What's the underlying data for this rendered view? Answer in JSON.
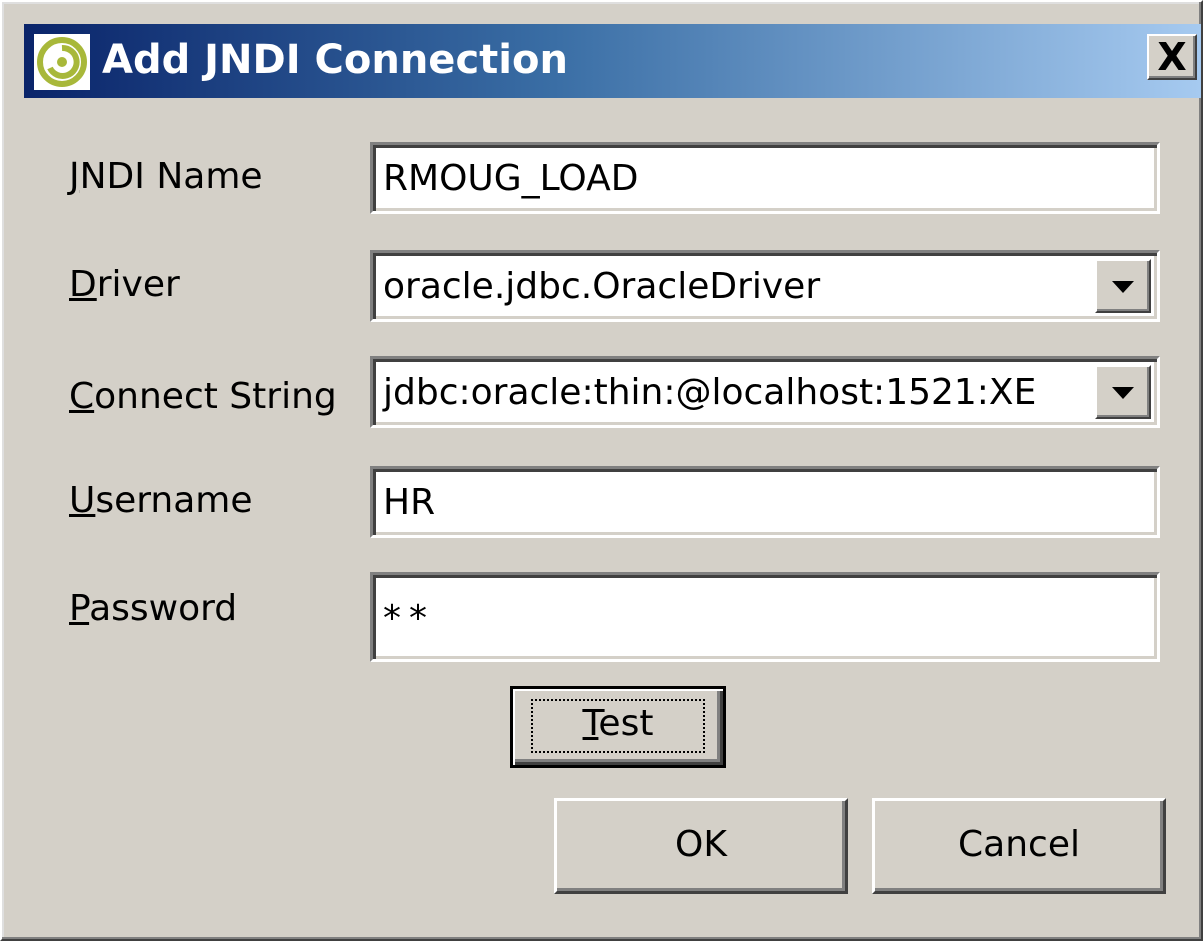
{
  "window": {
    "title": "Add JNDI Connection",
    "close_glyph": "X"
  },
  "form": {
    "jndi_name": {
      "label_mn": "J",
      "label_rest": "NDI Name",
      "value": "RMOUG_LOAD"
    },
    "driver": {
      "label_mn": "D",
      "label_rest": "river",
      "value": "oracle.jdbc.OracleDriver"
    },
    "connect_string": {
      "label_mn": "C",
      "label_rest": "onnect String",
      "value": "jdbc:oracle:thin:@localhost:1521:XE"
    },
    "username": {
      "label_mn": "U",
      "label_rest": "sername",
      "value": "HR"
    },
    "password": {
      "label_mn": "P",
      "label_rest": "assword",
      "value": "**"
    }
  },
  "buttons": {
    "test": {
      "mn": "T",
      "rest": "est"
    },
    "ok": "OK",
    "cancel": "Cancel"
  },
  "colors": {
    "dialog_bg": "#d4d0c8",
    "title_start": "#0a246a",
    "title_end": "#a6caf0",
    "title_text": "#ffffff",
    "icon": "#a8b83a"
  },
  "icons": {
    "app": "swirl-icon",
    "dropdown": "chevron-down-icon"
  }
}
